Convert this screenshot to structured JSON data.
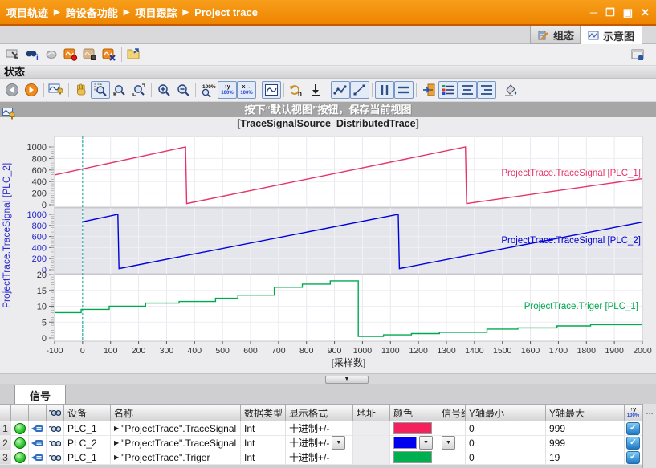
{
  "window": {
    "breadcrumb": [
      "项目轨迹",
      "跨设备功能",
      "项目跟踪",
      "Project trace"
    ]
  },
  "view_tabs": {
    "configuration": "组态",
    "diagram": "示意图"
  },
  "status_row": {
    "label": "状态"
  },
  "overlay": {
    "hint": "按下“默认视图”按钮，保存当前视图",
    "source": "[TraceSignalSource_DistributedTrace]"
  },
  "toolbar_main": {
    "icons": [
      "transfer-trace",
      "properties-binoculars",
      "compare",
      "record-trace",
      "stop-trace",
      "discard-trace",
      "add-measurement"
    ],
    "right_icons": [
      "editor-layout"
    ]
  },
  "toolbar_chart": {
    "icons": [
      "back",
      "forward",
      "default-view",
      "pan-hand",
      "zoom-select",
      "zoom-drag",
      "zoom-area",
      "zoom-in",
      "zoom-out",
      "zoom-100",
      "scale-y-100",
      "scale-x-100",
      "fit-view",
      "samples",
      "export",
      "interpolate",
      "step-curve",
      "vertical-cursor",
      "horizontal-cursor",
      "legend-position",
      "legend",
      "align-center",
      "align-right",
      "background-color"
    ]
  },
  "chart_data": {
    "type": "line",
    "xlabel": "[采样数]",
    "xlim": [
      -100,
      2000
    ],
    "x_tick_step": 100,
    "grid": true,
    "legend_position": "right-inline",
    "y_axis_label_left": "ProjectTrace.TraceSignal [PLC_2]",
    "trigger_x": 0,
    "subplots": [
      {
        "name": "ProjectTrace.TraceSignal [PLC_1]",
        "color": "#E63468",
        "ylim": [
          0,
          1000
        ],
        "yticks": [
          0,
          200,
          400,
          600,
          800,
          1000
        ],
        "tick_color": "#333333",
        "band": false,
        "points": [
          [
            -100,
            515
          ],
          [
            368,
            1000
          ],
          [
            372,
            20
          ],
          [
            1368,
            1000
          ],
          [
            1372,
            20
          ],
          [
            2000,
            450
          ]
        ]
      },
      {
        "name": "ProjectTrace.TraceSignal [PLC_2]",
        "color": "#0000D8",
        "ylim": [
          0,
          1000
        ],
        "yticks": [
          0,
          200,
          400,
          600,
          800,
          1000
        ],
        "tick_color": "#2222CC",
        "band": true,
        "points": [
          [
            0,
            865
          ],
          [
            126,
            1000
          ],
          [
            130,
            20
          ],
          [
            1128,
            1000
          ],
          [
            1132,
            20
          ],
          [
            2000,
            860
          ]
        ]
      },
      {
        "name": "ProjectTrace.Triger [PLC_1]",
        "color": "#00A84F",
        "ylim": [
          0,
          20
        ],
        "yticks": [
          0,
          5,
          10,
          15,
          20
        ],
        "tick_color": "#333333",
        "band": false,
        "points": [
          [
            -100,
            8
          ],
          [
            -5,
            8
          ],
          [
            -5,
            9
          ],
          [
            95,
            9
          ],
          [
            95,
            10
          ],
          [
            225,
            10
          ],
          [
            225,
            11
          ],
          [
            345,
            11
          ],
          [
            345,
            11.5
          ],
          [
            475,
            11.5
          ],
          [
            475,
            12.5
          ],
          [
            555,
            12.5
          ],
          [
            555,
            13.5
          ],
          [
            685,
            13.5
          ],
          [
            685,
            16
          ],
          [
            785,
            16
          ],
          [
            785,
            17
          ],
          [
            885,
            17
          ],
          [
            885,
            18
          ],
          [
            985,
            18
          ],
          [
            985,
            0.5
          ],
          [
            1075,
            0.5
          ],
          [
            1075,
            1
          ],
          [
            1175,
            1
          ],
          [
            1175,
            1.4
          ],
          [
            1275,
            1.4
          ],
          [
            1275,
            1.8
          ],
          [
            1445,
            1.8
          ],
          [
            1445,
            2.8
          ],
          [
            1555,
            2.8
          ],
          [
            1555,
            3.2
          ],
          [
            1695,
            3.2
          ],
          [
            1695,
            3.8
          ],
          [
            1815,
            3.8
          ],
          [
            1815,
            4.2
          ],
          [
            2000,
            4.2
          ]
        ]
      }
    ]
  },
  "signals": {
    "tab_label": "信号",
    "columns": [
      "设备",
      "名称",
      "数据类型",
      "显示格式",
      "地址",
      "颜色",
      "信号组",
      "Y轴最小",
      "Y轴最大"
    ],
    "more_label": "...",
    "rows": [
      {
        "index": "1",
        "device": "PLC_1",
        "name": "\"ProjectTrace\".TraceSignal",
        "data_type": "Int",
        "display_format": "十进制+/-",
        "address": "",
        "color": "#F5215C",
        "signal_group": "",
        "y_min": "0",
        "y_max": "999",
        "visible": true
      },
      {
        "index": "2",
        "device": "PLC_2",
        "name": "\"ProjectTrace\".TraceSignal",
        "data_type": "Int",
        "display_format": "十进制+/-",
        "address": "",
        "color": "#0000F0",
        "signal_group": "",
        "y_min": "0",
        "y_max": "999",
        "visible": true
      },
      {
        "index": "3",
        "device": "PLC_1",
        "name": "\"ProjectTrace\".Triger",
        "data_type": "Int",
        "display_format": "十进制+/-",
        "address": "",
        "color": "#00B050",
        "signal_group": "",
        "y_min": "0",
        "y_max": "19",
        "visible": true
      }
    ]
  }
}
